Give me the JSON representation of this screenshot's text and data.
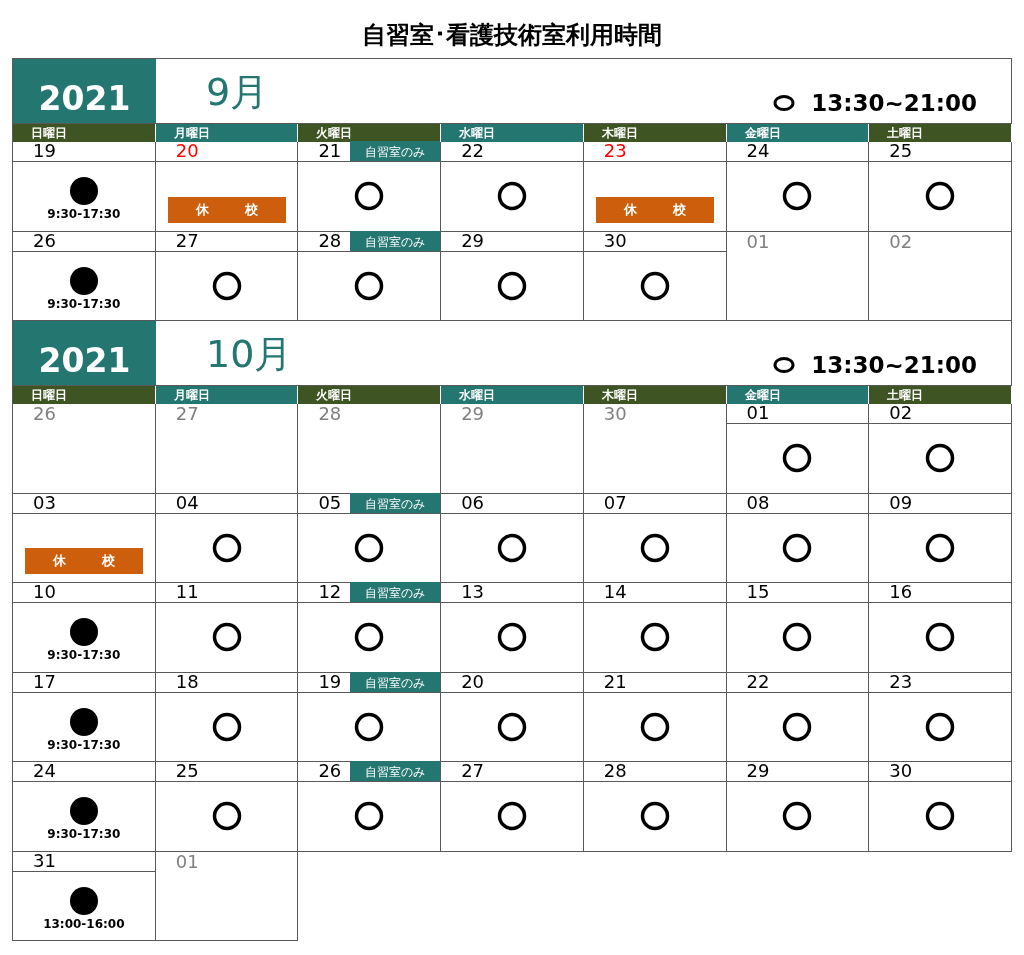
{
  "title": "自習室･看護技術室利用時間",
  "months": [
    {
      "year": "2021",
      "month": "9月",
      "legend": "13:30~21:00",
      "weekdays": [
        "日曜日",
        "月曜日",
        "火曜日",
        "水曜日",
        "木曜日",
        "金曜日",
        "土曜日"
      ],
      "weeks": [
        [
          {
            "date": "19",
            "kind": "full",
            "holiday": false,
            "hours": "9:30-17:30"
          },
          {
            "date": "20",
            "kind": "closed",
            "holiday": true,
            "closure": [
              "休",
              "校"
            ]
          },
          {
            "date": "21",
            "kind": "open",
            "holiday": false,
            "tag": "自習室のみ"
          },
          {
            "date": "22",
            "kind": "open",
            "holiday": false
          },
          {
            "date": "23",
            "kind": "closed",
            "holiday": true,
            "closure": [
              "休",
              "校"
            ]
          },
          {
            "date": "24",
            "kind": "open",
            "holiday": false
          },
          {
            "date": "25",
            "kind": "open",
            "holiday": false
          }
        ],
        [
          {
            "date": "26",
            "kind": "full",
            "holiday": false,
            "hours": "9:30-17:30"
          },
          {
            "date": "27",
            "kind": "open",
            "holiday": false
          },
          {
            "date": "28",
            "kind": "open",
            "holiday": false,
            "tag": "自習室のみ"
          },
          {
            "date": "29",
            "kind": "open",
            "holiday": false
          },
          {
            "date": "30",
            "kind": "open",
            "holiday": false
          },
          {
            "date": "01",
            "kind": "outside",
            "holiday": false
          },
          {
            "date": "02",
            "kind": "outside",
            "holiday": false
          }
        ]
      ]
    },
    {
      "year": "2021",
      "month": "10月",
      "legend": "13:30~21:00",
      "weekdays": [
        "日曜日",
        "月曜日",
        "火曜日",
        "水曜日",
        "木曜日",
        "金曜日",
        "土曜日"
      ],
      "weeks": [
        [
          {
            "date": "26",
            "kind": "outside",
            "holiday": false
          },
          {
            "date": "27",
            "kind": "outside",
            "holiday": false
          },
          {
            "date": "28",
            "kind": "outside",
            "holiday": false
          },
          {
            "date": "29",
            "kind": "outside",
            "holiday": false
          },
          {
            "date": "30",
            "kind": "outside",
            "holiday": false
          },
          {
            "date": "01",
            "kind": "open",
            "holiday": false
          },
          {
            "date": "02",
            "kind": "open",
            "holiday": false
          }
        ],
        [
          {
            "date": "03",
            "kind": "closed",
            "holiday": false,
            "closure": [
              "休",
              "校"
            ]
          },
          {
            "date": "04",
            "kind": "open",
            "holiday": false
          },
          {
            "date": "05",
            "kind": "open",
            "holiday": false,
            "tag": "自習室のみ"
          },
          {
            "date": "06",
            "kind": "open",
            "holiday": false
          },
          {
            "date": "07",
            "kind": "open",
            "holiday": false
          },
          {
            "date": "08",
            "kind": "open",
            "holiday": false
          },
          {
            "date": "09",
            "kind": "open",
            "holiday": false
          }
        ],
        [
          {
            "date": "10",
            "kind": "full",
            "holiday": false,
            "hours": "9:30-17:30"
          },
          {
            "date": "11",
            "kind": "open",
            "holiday": false
          },
          {
            "date": "12",
            "kind": "open",
            "holiday": false,
            "tag": "自習室のみ"
          },
          {
            "date": "13",
            "kind": "open",
            "holiday": false
          },
          {
            "date": "14",
            "kind": "open",
            "holiday": false
          },
          {
            "date": "15",
            "kind": "open",
            "holiday": false
          },
          {
            "date": "16",
            "kind": "open",
            "holiday": false
          }
        ],
        [
          {
            "date": "17",
            "kind": "full",
            "holiday": false,
            "hours": "9:30-17:30"
          },
          {
            "date": "18",
            "kind": "open",
            "holiday": false
          },
          {
            "date": "19",
            "kind": "open",
            "holiday": false,
            "tag": "自習室のみ"
          },
          {
            "date": "20",
            "kind": "open",
            "holiday": false
          },
          {
            "date": "21",
            "kind": "open",
            "holiday": false
          },
          {
            "date": "22",
            "kind": "open",
            "holiday": false
          },
          {
            "date": "23",
            "kind": "open",
            "holiday": false
          }
        ],
        [
          {
            "date": "24",
            "kind": "full",
            "holiday": false,
            "hours": "9:30-17:30"
          },
          {
            "date": "25",
            "kind": "open",
            "holiday": false
          },
          {
            "date": "26",
            "kind": "open",
            "holiday": false,
            "tag": "自習室のみ"
          },
          {
            "date": "27",
            "kind": "open",
            "holiday": false
          },
          {
            "date": "28",
            "kind": "open",
            "holiday": false
          },
          {
            "date": "29",
            "kind": "open",
            "holiday": false
          },
          {
            "date": "30",
            "kind": "open",
            "holiday": false
          }
        ],
        [
          {
            "date": "31",
            "kind": "full",
            "holiday": false,
            "hours": "13:00-16:00"
          },
          {
            "date": "01",
            "kind": "outside",
            "holiday": false
          }
        ]
      ]
    }
  ]
}
